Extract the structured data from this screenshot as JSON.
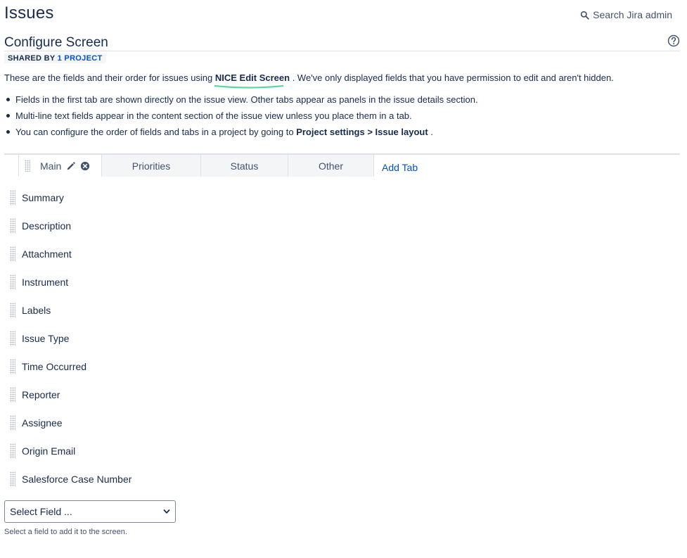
{
  "header": {
    "title": "Issues",
    "search_label": "Search Jira admin"
  },
  "screen": {
    "title": "Configure Screen",
    "shared_by_label": "SHARED BY",
    "shared_by_link": "1 PROJECT",
    "intro_before": "These are the fields and their order for issues using ",
    "screen_name": "NICE Edit Screen",
    "intro_after": " . We've only displayed fields that you have permission to edit and aren't hidden.",
    "highlight_color": "#57d9a3"
  },
  "bullets": [
    "Fields in the first tab are shown directly on the issue view. Other tabs appear as panels in the issue details section.",
    "Multi-line text fields appear in the content section of the issue view unless you place them in a tab."
  ],
  "bullet3": {
    "before": "You can configure the order of fields and tabs in a project by going to ",
    "strong1": "Project settings",
    "sep": " > ",
    "strong2": "Issue layout",
    "after": " ."
  },
  "tabs": [
    {
      "label": "Main",
      "active": true
    },
    {
      "label": "Priorities",
      "active": false
    },
    {
      "label": "Status",
      "active": false
    },
    {
      "label": "Other",
      "active": false
    }
  ],
  "add_tab_label": "Add Tab",
  "fields": [
    "Summary",
    "Description",
    "Attachment",
    "Instrument",
    "Labels",
    "Issue Type",
    "Time Occurred",
    "Reporter",
    "Assignee",
    "Origin Email",
    "Salesforce Case Number"
  ],
  "select_field": {
    "value": "Select Field ...",
    "helper": "Select a field to add it to the screen."
  },
  "colors": {
    "link": "#0052cc",
    "text": "#172b4d",
    "tab_inactive_bg": "#f4f5f7"
  }
}
